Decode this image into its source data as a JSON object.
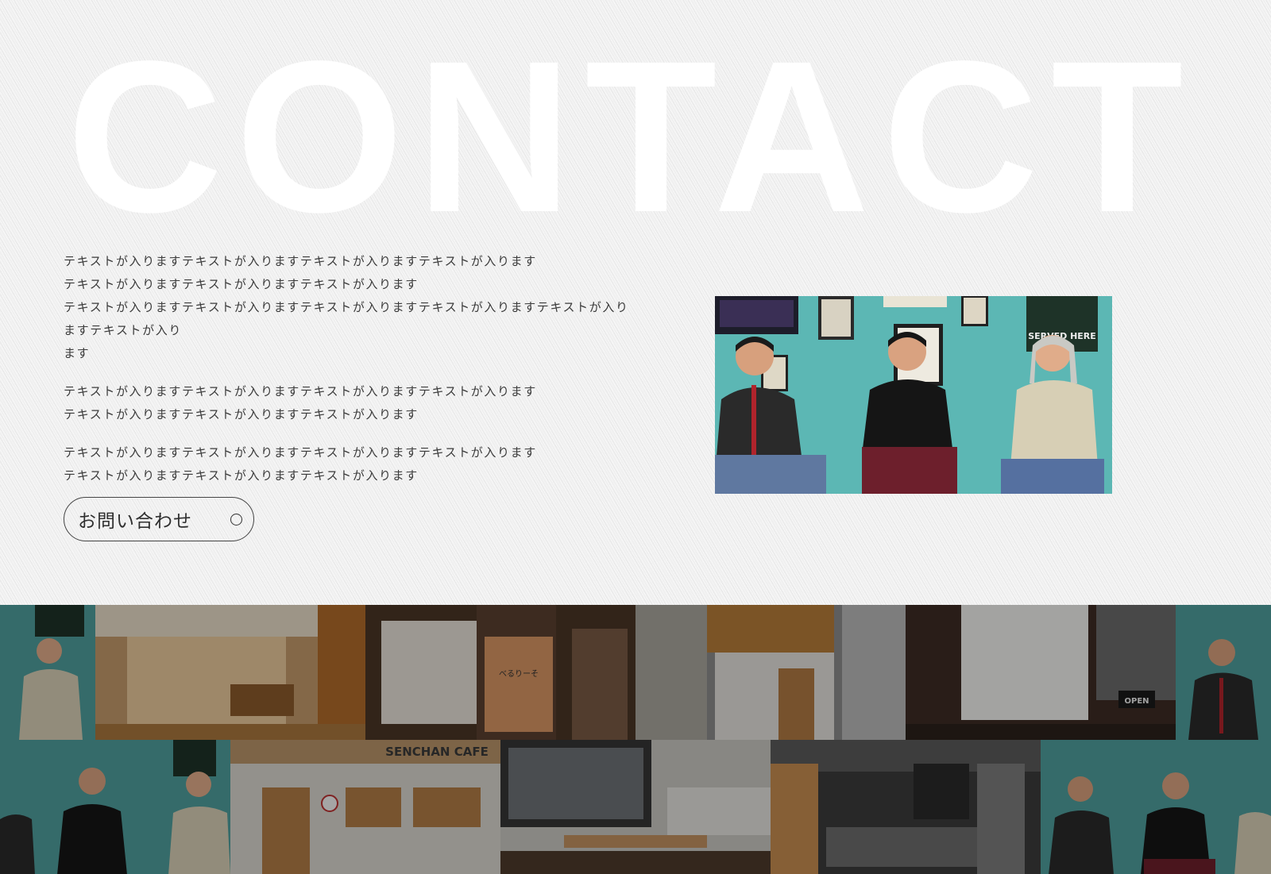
{
  "contact": {
    "heading": "CONTACT",
    "paragraphs": [
      {
        "lines": [
          "テキストが入りますテキストが入りますテキストが入りますテキストが入ります",
          "テキストが入りますテキストが入りますテキストが入ります",
          "テキストが入りますテキストが入りますテキストが入りますテキストが入りますテキストが入りますテキストが入り",
          "ます"
        ]
      },
      {
        "lines": [
          "テキストが入りますテキストが入りますテキストが入りますテキストが入ります",
          "テキストが入りますテキストが入りますテキストが入ります"
        ]
      },
      {
        "lines": [
          "テキストが入りますテキストが入りますテキストが入りますテキストが入ります",
          "テキストが入りますテキストが入りますテキストが入ります"
        ]
      }
    ],
    "button": {
      "label": "お問い合わせ",
      "icon": "circle-icon"
    },
    "photo": {
      "sign_text": "SERVED HERE"
    }
  },
  "gallery": {
    "shop_names": [
      "べるりーそ",
      "SENCHAN CAFE",
      "OPEN"
    ]
  },
  "colors": {
    "background": "#efefef",
    "heading": "#ffffff",
    "text": "#3a3a3a",
    "wall_teal": "#5cb7b4"
  }
}
